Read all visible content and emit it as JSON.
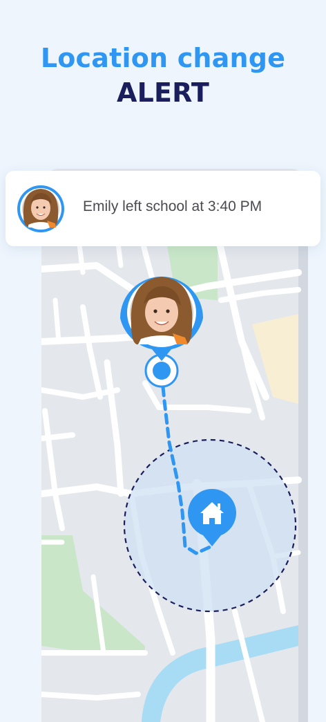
{
  "headline": {
    "line1": "Location change",
    "line2": "ALERT"
  },
  "notification": {
    "message": "Emily left school at 3:40 PM"
  },
  "map": {
    "child_marker_icon": "child-avatar-pin",
    "home_marker_icon": "home-icon",
    "geofence": "home-zone"
  },
  "colors": {
    "accent_blue": "#2f97f2",
    "headline_dark": "#1a1e5c",
    "geofence_fill": "#cfe0f3",
    "geofence_border": "#1a1e5c",
    "route": "#2f97f2"
  }
}
